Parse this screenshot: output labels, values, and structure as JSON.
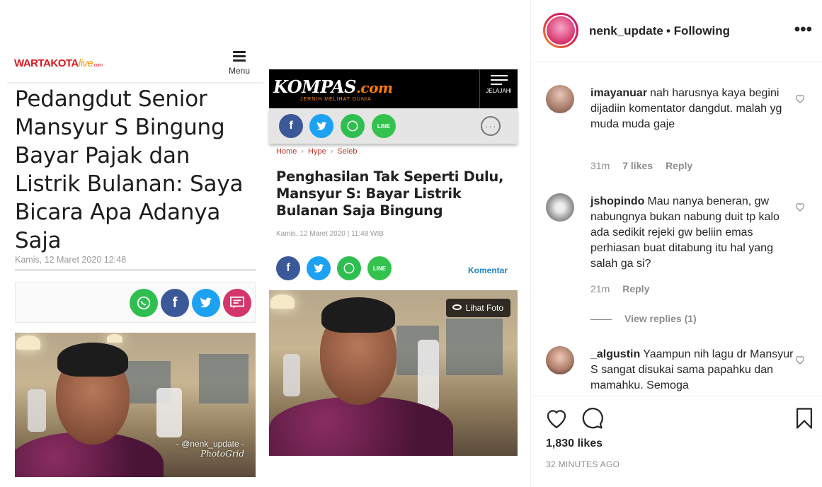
{
  "post_image": {
    "wartakota": {
      "logo_main": "WARTAKOTA",
      "logo_live": "live",
      "logo_com": ".com",
      "menu_label": "Menu",
      "headline": "Pedangdut Senior Mansyur S Bingung Bayar Pajak dan Listrik Bulanan: Saya Bicara Apa Adanya Saja",
      "date": "Kamis, 12 Maret 2020 12:48",
      "share_icons": [
        "whatsapp-icon",
        "facebook-icon",
        "twitter-icon",
        "comment-icon"
      ],
      "share_colors": [
        "#2fbe50",
        "#3b5998",
        "#1da1f2",
        "#d4356b"
      ]
    },
    "kompas": {
      "logo": "KOMPAS",
      "logo_suffix": ".com",
      "tagline": "JERNIH MELIHAT DUNIA",
      "jelajahi": "JELAJAHI",
      "breadcrumb": [
        "Home",
        "Hype",
        "Seleb"
      ],
      "headline": "Penghasilan Tak Seperti Dulu, Mansyur S: Bayar Listrik Bulanan Saja Bingung",
      "date": "Kamis, 12 Maret 2020 | 11:48 WIB",
      "komentar": "Komentar",
      "lihat_foto": "Lihat Foto",
      "share_colors": [
        "#3b5998",
        "#1da1f2",
        "#2fbe50",
        "#32c24d"
      ]
    },
    "watermark": {
      "handle": "- @nenk_update -",
      "app": "PhotoGrid"
    }
  },
  "instagram": {
    "header": {
      "username": "nenk_update",
      "following": "• Following",
      "more": "•••"
    },
    "comments": [
      {
        "user": "imayanuar",
        "text": "nah harusnya kaya begini dijadiin komentator dangdut. malah yg muda muda gaje",
        "time": "31m",
        "likes": "7 likes",
        "reply": "Reply"
      },
      {
        "user": "jshopindo",
        "text": "Mau nanya beneran, gw nabungnya bukan nabung duit tp kalo ada sedikit rejeki gw beliin emas perhiasan buat ditabung itu hal yang salah ga si?",
        "time": "21m",
        "reply": "Reply",
        "view_replies": "View replies (1)"
      },
      {
        "user": "_algustin",
        "text": "Yaampun nih lagu dr Mansyur S sangat disukai sama papahku dan mamahku. Semoga"
      }
    ],
    "likes": "1,830 likes",
    "posted": "32 MINUTES AGO"
  }
}
